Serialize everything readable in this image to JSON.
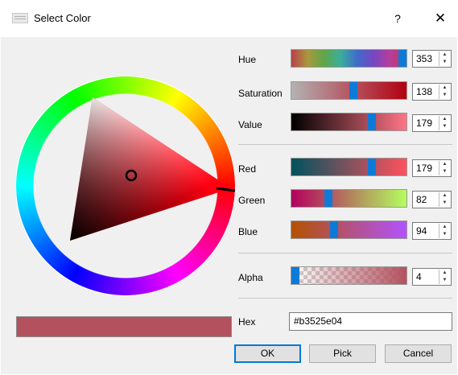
{
  "window": {
    "title": "Select Color",
    "help_label": "?",
    "close_label": "✕",
    "app_icon": "window-icon"
  },
  "picker": {
    "current_color": "#b3525e",
    "hue_marker_angle_deg": 353
  },
  "channels": {
    "hue": {
      "label": "Hue",
      "value": "353",
      "max": 359,
      "gradient": "linear-gradient(to right,#b9414b,#a9983d,#5ea64a,#3bae9c,#3f6cc9,#7547c1,#b83d9b,#c13b55)"
    },
    "saturation": {
      "label": "Saturation",
      "value": "138",
      "max": 255,
      "gradient": "linear-gradient(to right,#b3b3b3,#b3525e 54%,#b3000e)"
    },
    "value": {
      "label": "Value",
      "value": "179",
      "max": 255,
      "gradient": "linear-gradient(to right,#000000,#b3525e 70%,#ff7585)"
    },
    "red": {
      "label": "Red",
      "value": "179",
      "max": 255,
      "gradient": "linear-gradient(to right,#00525e,#ff525e)"
    },
    "green": {
      "label": "Green",
      "value": "82",
      "max": 255,
      "gradient": "linear-gradient(to right,#b3005e,#b3ff5e)"
    },
    "blue": {
      "label": "Blue",
      "value": "94",
      "max": 255,
      "gradient": "linear-gradient(to right,#b35200,#b352ff)"
    },
    "alpha": {
      "label": "Alpha",
      "value": "4",
      "max": 255,
      "gradient": "linear-gradient(to right,rgba(179,82,94,0),rgba(179,82,94,1))"
    }
  },
  "hex": {
    "label": "Hex",
    "value": "#b3525e04"
  },
  "buttons": {
    "ok": "OK",
    "pick": "Pick",
    "cancel": "Cancel"
  },
  "icons": {
    "help": "help-icon",
    "close": "close-icon",
    "spin_up": "arrow-up-icon",
    "spin_down": "arrow-down-icon"
  },
  "colors": {
    "slider_handle": "#0e7ad8",
    "default_button_border": "#0078d7"
  }
}
